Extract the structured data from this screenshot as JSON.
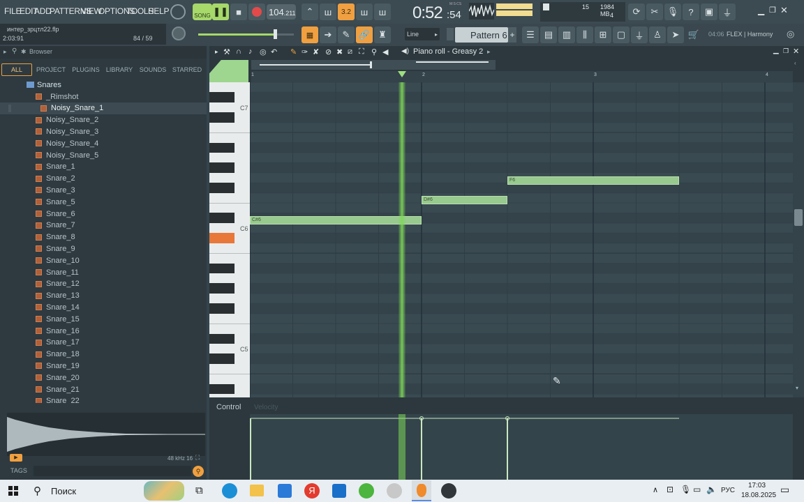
{
  "menu": [
    "FILE",
    "EDIT",
    "ADD",
    "PATTERNS",
    "VIEW",
    "OPTIONS",
    "TOOLS",
    "HELP"
  ],
  "transport": {
    "mode": "SONG",
    "tempo_main": "104",
    "tempo_frac": ".211",
    "time_main": "0:52",
    "time_sec": ":54",
    "time_unit": "M:S:CS"
  },
  "monitor": {
    "voices": "15",
    "memory": "1984 MB",
    "cpu": "4"
  },
  "project": {
    "filename": "интер_зрцтл22.flp",
    "position": "2:03:91",
    "counter": "84 / 59"
  },
  "snap": {
    "label": "Line"
  },
  "pattern": {
    "label": "Pattern 6",
    "plus": "+"
  },
  "hint": {
    "time": "04:06",
    "text": "FLEX | Harmony"
  },
  "browser": {
    "title": "Browser",
    "tabs": [
      "ALL",
      "PROJECT",
      "PLUGINS",
      "LIBRARY",
      "SOUNDS",
      "STARRED"
    ],
    "folder": "Snares",
    "items": [
      "_Rimshot",
      "Noisy_Snare_1",
      "Noisy_Snare_2",
      "Noisy_Snare_3",
      "Noisy_Snare_4",
      "Noisy_Snare_5",
      "Snare_1",
      "Snare_2",
      "Snare_3",
      "Snare_5",
      "Snare_6",
      "Snare_7",
      "Snare_8",
      "Snare_9",
      "Snare_10",
      "Snare_11",
      "Snare_12",
      "Snare_13",
      "Snare_14",
      "Snare_15",
      "Snare_16",
      "Snare_17",
      "Snare_18",
      "Snare_19",
      "Snare_20",
      "Snare_21",
      "Snare_22"
    ],
    "selected_index": 1,
    "sample_info": "48 kHz 16",
    "tags_label": "TAGS"
  },
  "pianoroll": {
    "title": "Piano roll - Greasy 2",
    "bars": [
      "1",
      "2",
      "3",
      "4"
    ],
    "key_labels": [
      "C7",
      "C6",
      "C5"
    ],
    "notes": [
      {
        "label": "C#6"
      },
      {
        "label": "D#6"
      },
      {
        "label": "F6"
      }
    ],
    "control_label": "Control",
    "control_param": "Velocity"
  },
  "taskbar": {
    "search": "Поиск",
    "lang": "РУС",
    "time": "17:03",
    "date": "18.08.2025"
  },
  "colors": {
    "accent": "#f0a040",
    "note": "#98c98e",
    "playhead": "#7ed957",
    "record": "#e24a4a"
  }
}
